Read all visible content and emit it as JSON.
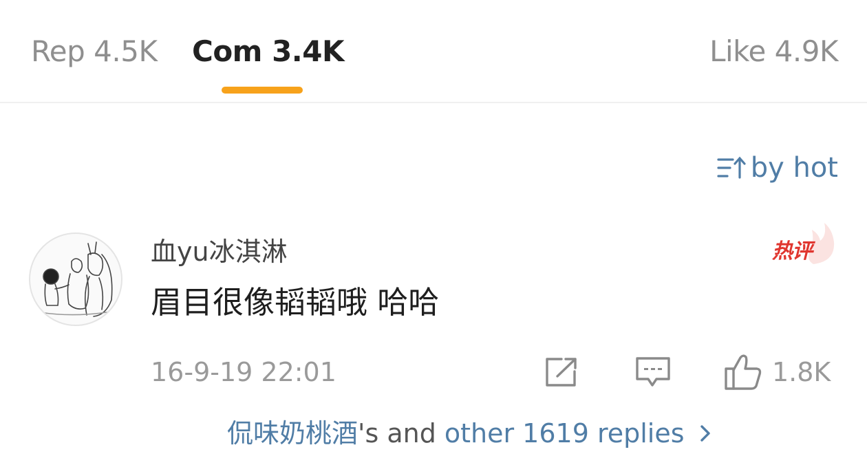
{
  "tabs": {
    "repost": "Rep 4.5K",
    "comments": "Com 3.4K",
    "like": "Like 4.9K"
  },
  "sort": {
    "label": "by hot",
    "icon": "sort-icon"
  },
  "comment": {
    "username": "血yu冰淇淋",
    "hot_badge": "热评",
    "text": "眉目很像韬韬哦 哈哈",
    "timestamp": "16-9-19 22:01",
    "like_count": "1.8K",
    "actions": {
      "share_icon": "share-icon",
      "comment_icon": "comment-icon",
      "like_icon": "thumbs-up-icon"
    },
    "replies": {
      "replier": "侃味奶桃酒",
      "connector": "'s and",
      "summary": "other 1619 replies"
    }
  },
  "colors": {
    "accent": "#f7a21b",
    "link": "#507da6",
    "hot": "#e0362f",
    "muted": "#9a9a9a"
  }
}
